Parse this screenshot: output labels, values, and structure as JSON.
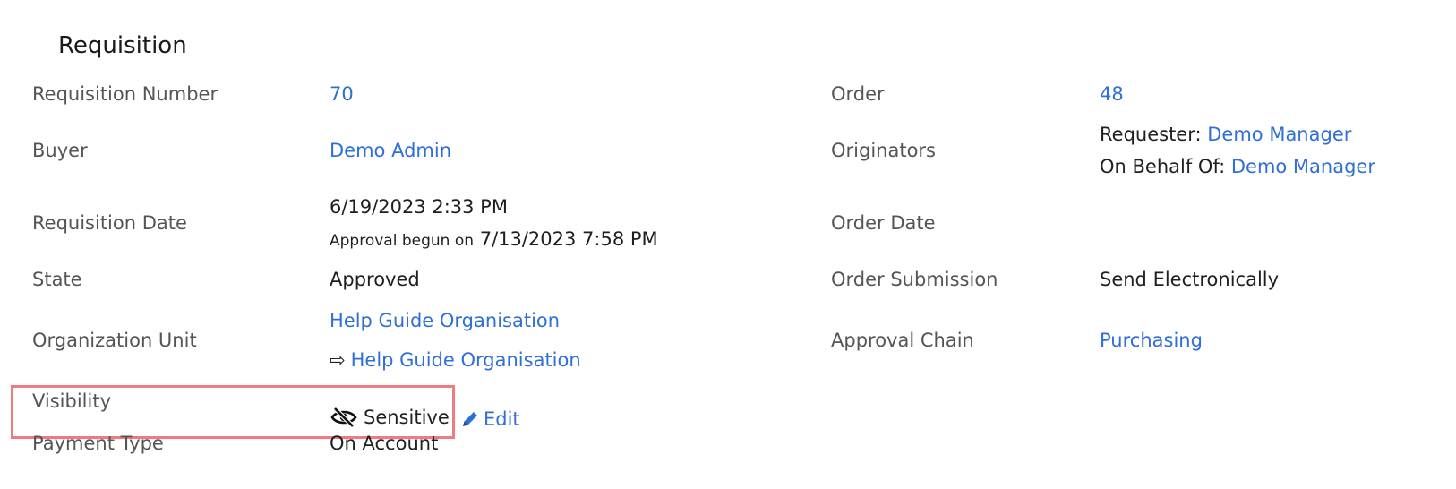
{
  "title": "Requisition",
  "left": {
    "requisition_number": {
      "label": "Requisition Number",
      "value": "70"
    },
    "buyer": {
      "label": "Buyer",
      "value": "Demo Admin"
    },
    "requisition_date": {
      "label": "Requisition Date",
      "value": "6/19/2023 2:33 PM",
      "approval_prefix": "Approval begun on",
      "approval_date": "7/13/2023 7:58 PM"
    },
    "state": {
      "label": "State",
      "value": "Approved"
    },
    "organization_unit": {
      "label": "Organization Unit",
      "value": "Help Guide Organisation",
      "child_arrow": "⇨",
      "child_value": "Help Guide Organisation"
    },
    "visibility": {
      "label": "Visibility",
      "value": "Sensitive",
      "icon": "eye-slash-icon",
      "edit_label": "Edit"
    },
    "payment_type": {
      "label": "Payment Type",
      "value": "On Account"
    }
  },
  "right": {
    "order": {
      "label": "Order",
      "value": "48"
    },
    "originators": {
      "label": "Originators",
      "requester_prefix": "Requester:",
      "requester_value": "Demo Manager",
      "behalf_prefix": "On Behalf Of:",
      "behalf_value": "Demo Manager"
    },
    "order_date": {
      "label": "Order Date",
      "value": ""
    },
    "order_submission": {
      "label": "Order Submission",
      "value": "Send Electronically"
    },
    "approval_chain": {
      "label": "Approval Chain",
      "value": "Purchasing"
    }
  },
  "colors": {
    "link": "#2f6fd6",
    "label": "#555555",
    "highlight": "#ef7a7f"
  }
}
